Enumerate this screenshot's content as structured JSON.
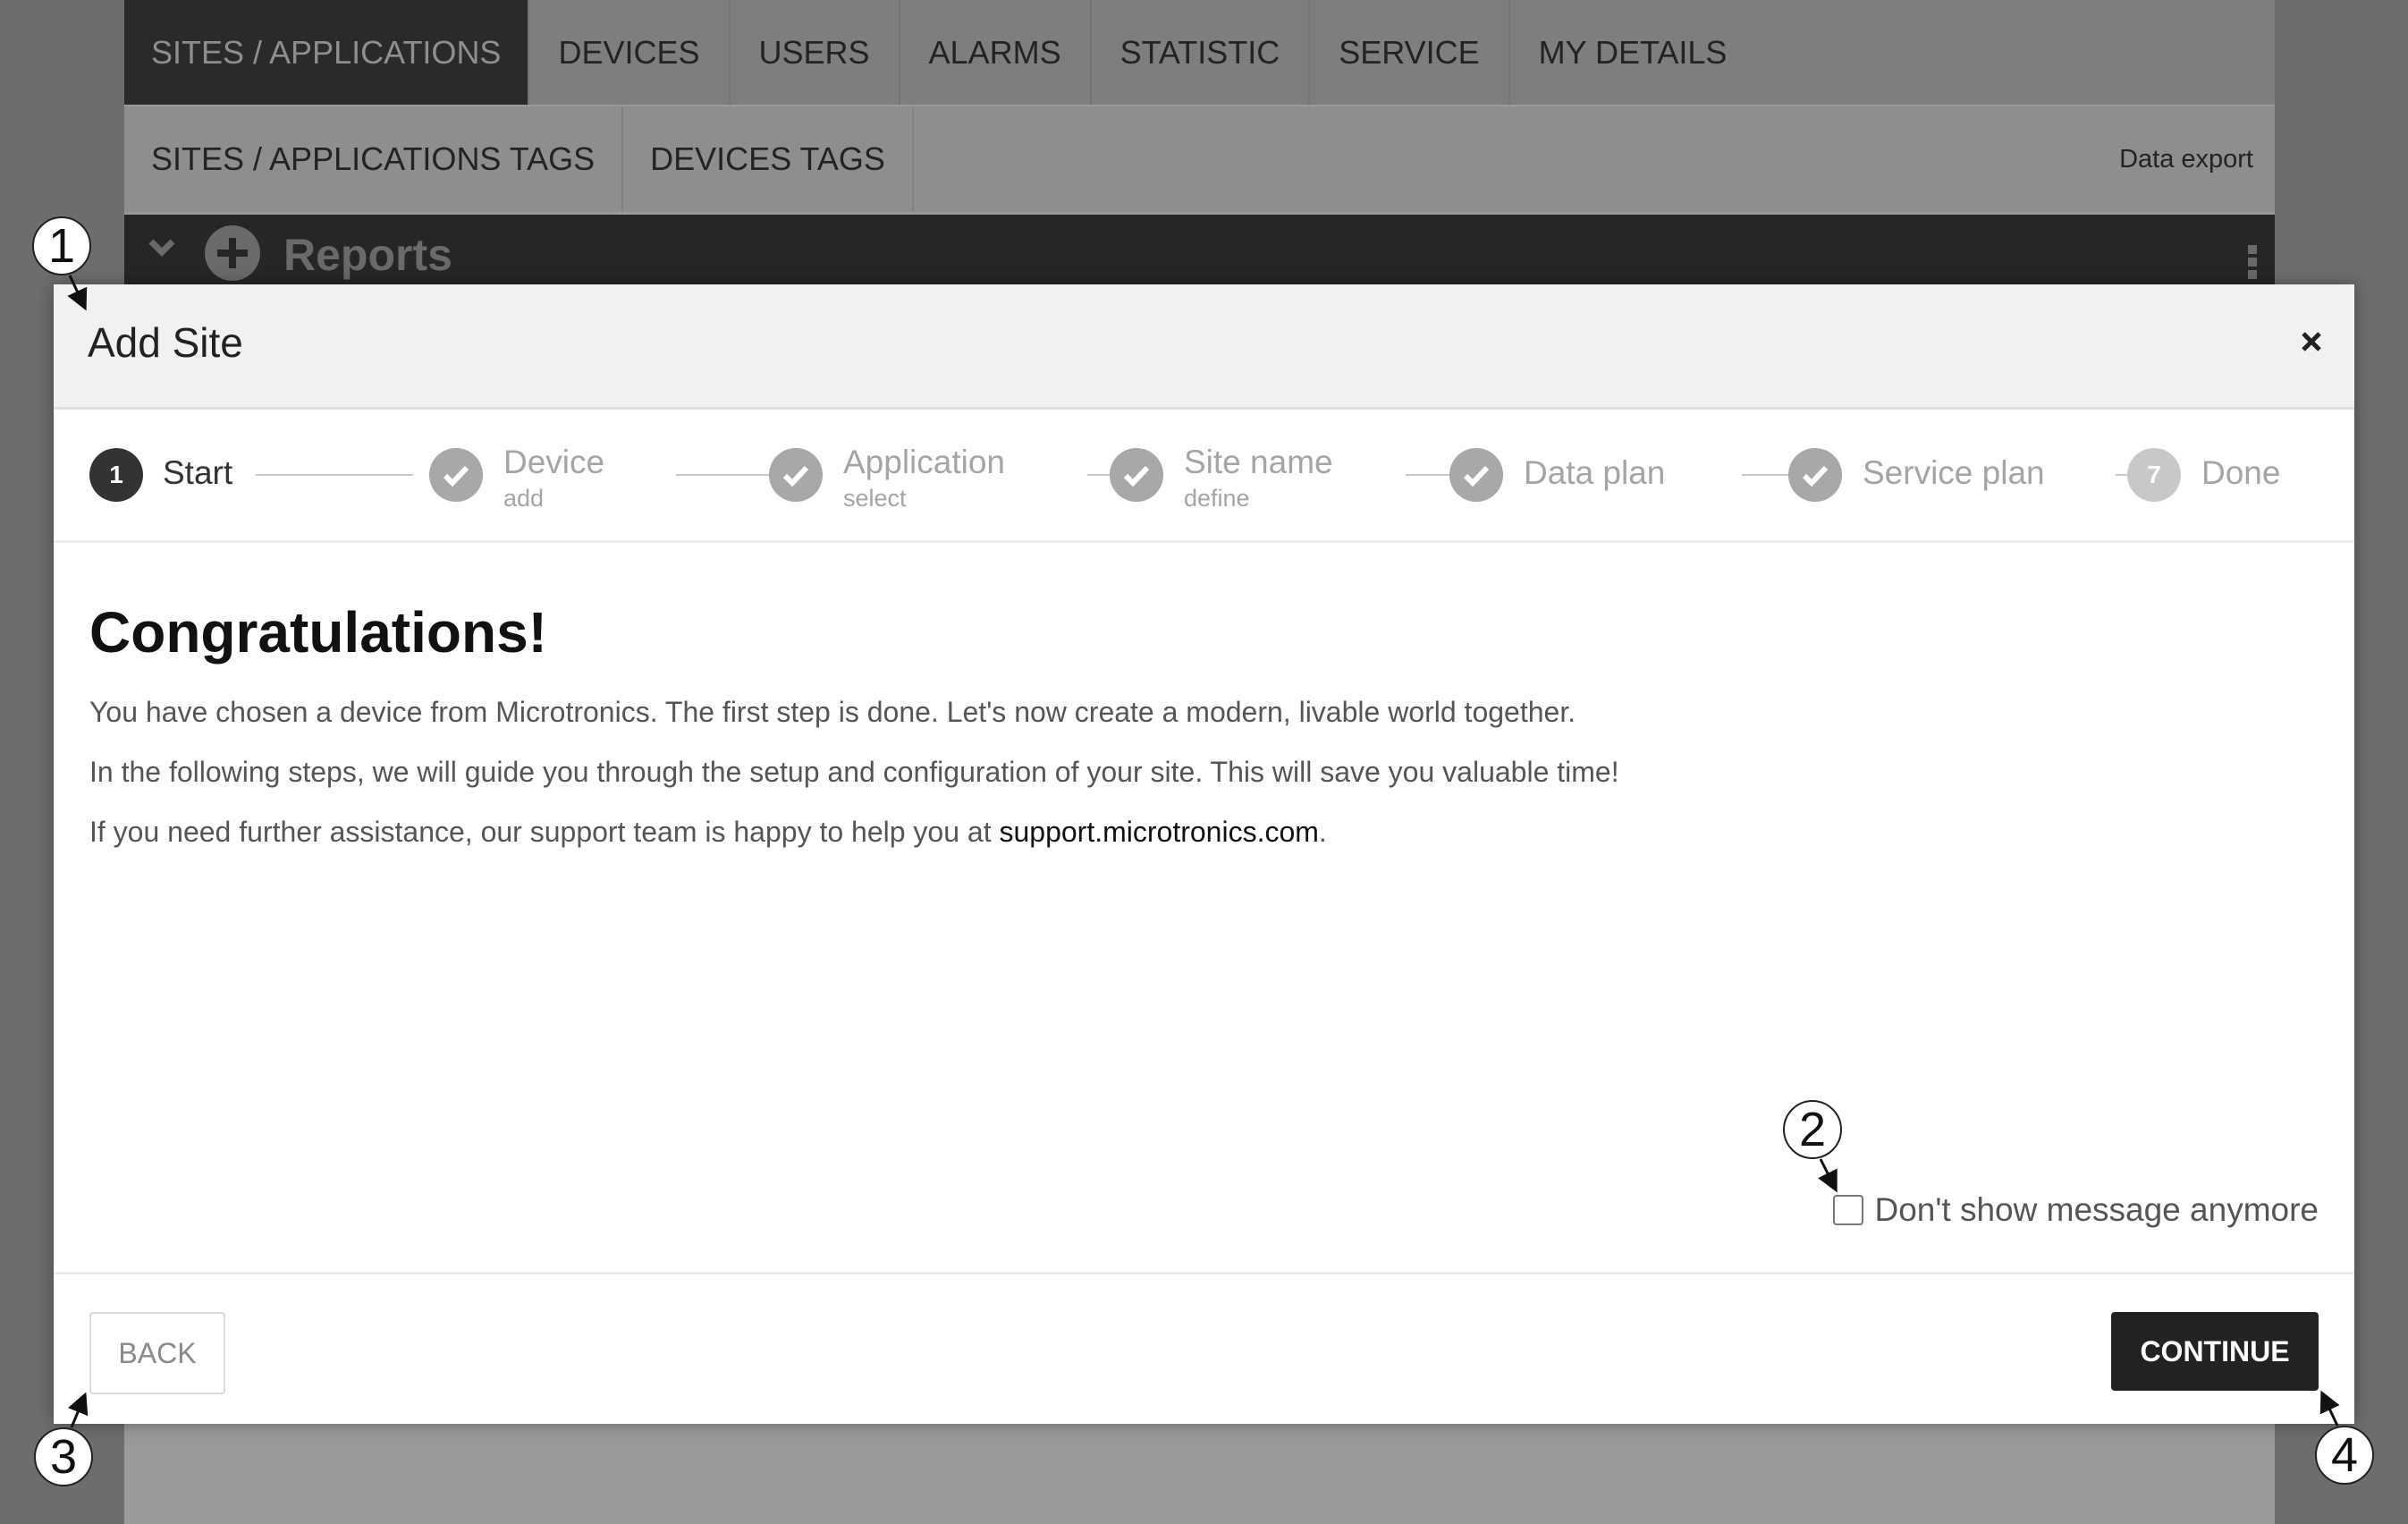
{
  "background": {
    "main_tabs": [
      "SITES / APPLICATIONS",
      "DEVICES",
      "USERS",
      "ALARMS",
      "STATISTIC",
      "SERVICE",
      "MY DETAILS"
    ],
    "sub_tabs": [
      "SITES / APPLICATIONS TAGS",
      "DEVICES TAGS"
    ],
    "data_export": "Data export",
    "reports_title": "Reports"
  },
  "modal": {
    "title": "Add Site",
    "close_icon": "close-icon",
    "steps": [
      {
        "number": "1",
        "label": "Start",
        "sub": "",
        "state": "current"
      },
      {
        "label": "Device",
        "sub": "add",
        "state": "done"
      },
      {
        "label": "Application",
        "sub": "select",
        "state": "done"
      },
      {
        "label": "Site name",
        "sub": "define",
        "state": "done"
      },
      {
        "label": "Data plan",
        "sub": "",
        "state": "done"
      },
      {
        "label": "Service plan",
        "sub": "",
        "state": "done"
      },
      {
        "number": "7",
        "label": "Done",
        "sub": "",
        "state": "pending"
      }
    ],
    "heading": "Congratulations!",
    "paragraphs": [
      "You have chosen a device from Microtronics. The first step is done. Let's now create a modern, livable world together.",
      "In the following steps, we will guide you through the setup and configuration of your site. This will save you valuable time!"
    ],
    "support_text": "If you need further assistance, our support team is happy to help you at ",
    "support_link": "support.microtronics.com",
    "support_suffix": ".",
    "dont_show_label": "Don't show message anymore",
    "dont_show_checked": false,
    "back_label": "BACK",
    "continue_label": "CONTINUE"
  },
  "callouts": [
    "1",
    "2",
    "3",
    "4"
  ],
  "colors": {
    "overlay": "#6d6d6d",
    "primary_button": "#222222",
    "step_done": "#a8a8a8",
    "step_current": "#333333"
  }
}
